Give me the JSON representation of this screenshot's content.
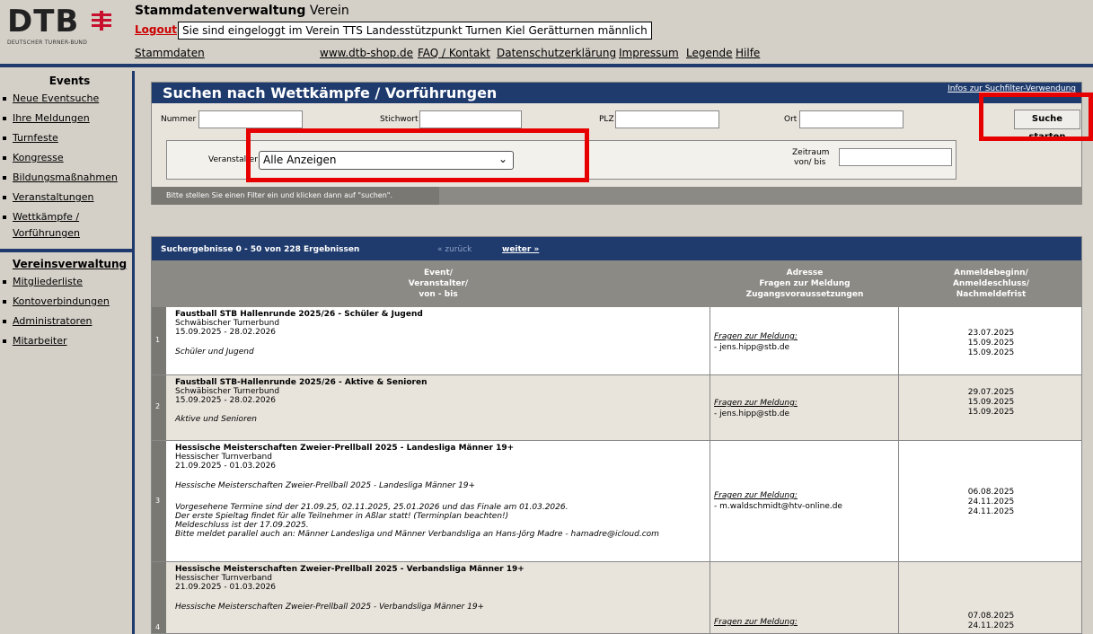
{
  "header": {
    "logo_text": "DTB",
    "logo_sub": "DEUTSCHER TURNER-BUND",
    "title_bold": "Stammdatenverwaltung",
    "title_rest": " Verein",
    "logout": "Logout",
    "login_info": "Sie sind eingeloggt im Verein TTS Landesstützpunkt Turnen Kiel Gerätturnen männlich",
    "nav": [
      "Stammdaten",
      "www.dtb-shop.de",
      "FAQ / Kontakt",
      "Datenschutzerklärung",
      "Impressum",
      "Legende",
      "Hilfe"
    ]
  },
  "sidebar": {
    "events_title": "Events",
    "events_items": [
      "Neue Eventsuche",
      "Ihre Meldungen",
      "Turnfeste",
      "Kongresse",
      "Bildungsmaßnahmen",
      "Veranstaltungen",
      "Wettkämpfe /",
      "Vorführungen"
    ],
    "verein_title": "Vereinsverwaltung",
    "verein_items": [
      "Mitgliederliste",
      "Kontoverbindungen",
      "Administratoren",
      "Mitarbeiter"
    ]
  },
  "search": {
    "title": "Suchen nach Wettkämpfe / Vorführungen",
    "info_link": "Infos zur Suchfilter-Verwendung",
    "nummer_label": "Nummer",
    "stichwort_label": "Stichwort",
    "plz_label": "PLZ",
    "ort_label": "Ort",
    "button": "Suche starten",
    "veranstalter_label": "Veranstalter",
    "veranstalter_value": "Alle Anzeigen",
    "zeitraum_label1": "Zeitraum",
    "zeitraum_label2": "von/ bis",
    "hint": "Bitte stellen Sie einen Filter ein und klicken dann auf \"suchen\"."
  },
  "results": {
    "summary": "Suchergebnisse 0 - 50 von 228 Ergebnissen",
    "back": "« zurück",
    "forward": "weiter »",
    "col1": [
      "Event/",
      "Veranstalter/",
      "von - bis"
    ],
    "col2": [
      "Adresse",
      "Fragen zur Meldung",
      "Zugangsvoraussetzungen"
    ],
    "col3": [
      "Anmeldebeginn/",
      "Anmeldeschluss/",
      "Nachmeldefrist"
    ],
    "fragen_label": "Fragen zur Meldung:",
    "rows": [
      {
        "num": "1",
        "title": "Faustball STB Hallenrunde 2025/26 - Schüler & Jugend",
        "org": "Schwäbischer Turnerbund",
        "dates": "15.09.2025 - 28.02.2026",
        "note": "Schüler und Jugend",
        "email": "- jens.hipp@stb.de",
        "d1": "23.07.2025",
        "d2": "15.09.2025",
        "d3": "15.09.2025"
      },
      {
        "num": "2",
        "title": "Faustball STB-Hallenrunde 2025/26 - Aktive & Senioren",
        "org": "Schwäbischer Turnerbund",
        "dates": "15.09.2025 - 28.02.2026",
        "note": "Aktive und Senioren",
        "email": "- jens.hipp@stb.de",
        "d1": "29.07.2025",
        "d2": "15.09.2025",
        "d3": "15.09.2025"
      },
      {
        "num": "3",
        "title": "Hessische Meisterschaften Zweier-Prellball 2025 - Landesliga Männer 19+",
        "org": "Hessischer Turnverband",
        "dates": "21.09.2025 - 01.03.2026",
        "note": "Hessische Meisterschaften Zweier-Prellball 2025 - Landesliga Männer 19+",
        "extra": [
          "Vorgesehene Termine sind der 21.09.25, 02.11.2025, 25.01.2026 und das Finale am 01.03.2026.",
          "Der erste Spieltag findet für alle Teilnehmer in Aßlar statt! (Terminplan beachten!)",
          "Meldeschluss ist der 17.09.2025.",
          "Bitte meldet parallel auch an: Männer Landesliga und Männer Verbandsliga an Hans-Jörg Madre - hamadre@icloud.com"
        ],
        "email": "- m.waldschmidt@htv-online.de",
        "d1": "06.08.2025",
        "d2": "24.11.2025",
        "d3": "24.11.2025"
      },
      {
        "num": "4",
        "title": "Hessische Meisterschaften Zweier-Prellball 2025 - Verbandsliga Männer 19+",
        "org": "Hessischer Turnverband",
        "dates": "21.09.2025 - 01.03.2026",
        "note": "Hessische Meisterschaften Zweier-Prellball 2025 - Verbandsliga Männer 19+",
        "d1": "07.08.2025",
        "d2": "24.11.2025"
      }
    ]
  }
}
